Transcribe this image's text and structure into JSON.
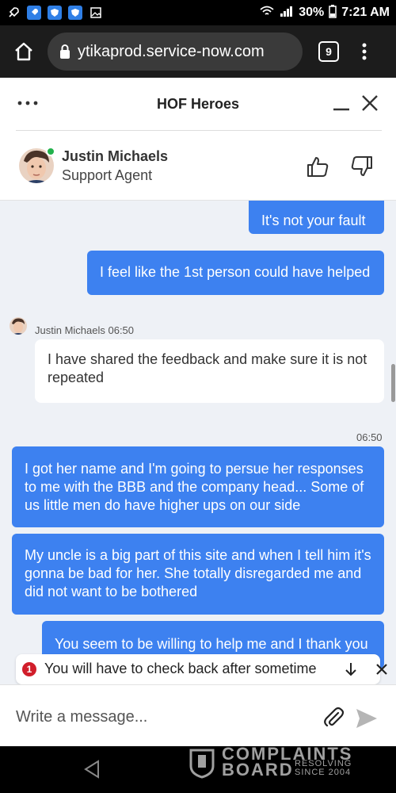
{
  "status_bar": {
    "battery": "30%",
    "time": "7:21 AM"
  },
  "browser": {
    "url": "ytikaprod.service-now.com",
    "tab_count": "9"
  },
  "chat": {
    "title": "HOF Heroes",
    "agent": {
      "name": "Justin Michaels",
      "role": "Support Agent"
    },
    "messages": {
      "out1": "It's not your fault",
      "out2": "I feel like the 1st person could have helped",
      "in_meta": "Justin Michaels 06:50",
      "in1": "I have shared the feedback and make sure it is not repeated",
      "time_stamp": "06:50",
      "out3": "I got her name and I'm going to persue her responses to me with the BBB and the company head... Some of us little men do have higher ups on our side",
      "out4": "My uncle is a big part of this site and when I tell him it's gonna be bad for her. She totally disregarded me and did not want to be bothered",
      "out5": "You seem to be willing to help me and I thank you"
    },
    "notice": {
      "badge": "1",
      "text": "You will have to check back after sometime"
    },
    "composer": {
      "placeholder": "Write a message..."
    }
  },
  "watermark": {
    "line1": "COMPLAINTS",
    "line2": "BOARD",
    "tagline": "RESOLVING SINCE 2004"
  },
  "colors": {
    "accent": "#3d81f0",
    "online": "#22b14c",
    "badge": "#d11e2b"
  }
}
